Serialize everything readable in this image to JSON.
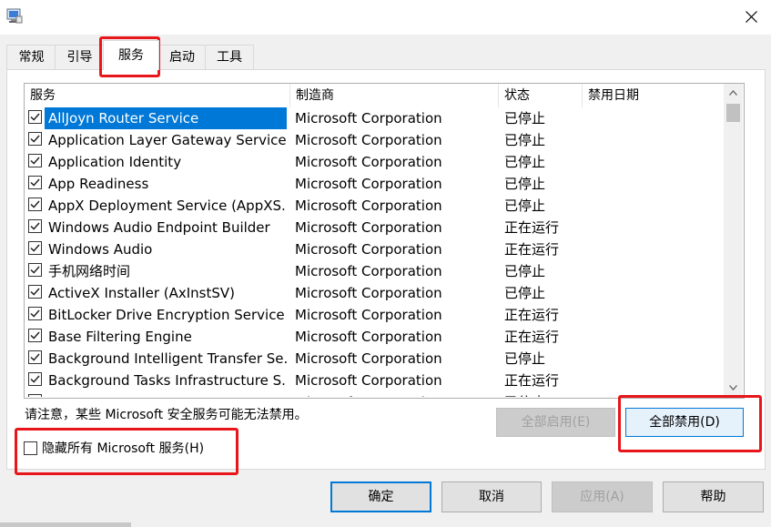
{
  "window": {
    "close_glyph": "✕"
  },
  "tabs": [
    {
      "label": "常规",
      "active": false
    },
    {
      "label": "引导",
      "active": false
    },
    {
      "label": "服务",
      "active": true
    },
    {
      "label": "启动",
      "active": false
    },
    {
      "label": "工具",
      "active": false
    }
  ],
  "services": {
    "columns": [
      "服务",
      "制造商",
      "状态",
      "禁用日期"
    ],
    "rows": [
      {
        "name": "AllJoyn Router Service",
        "maker": "Microsoft Corporation",
        "status": "已停止",
        "checked": true,
        "selected": true
      },
      {
        "name": "Application Layer Gateway Service",
        "maker": "Microsoft Corporation",
        "status": "已停止",
        "checked": true
      },
      {
        "name": "Application Identity",
        "maker": "Microsoft Corporation",
        "status": "已停止",
        "checked": true
      },
      {
        "name": "App Readiness",
        "maker": "Microsoft Corporation",
        "status": "已停止",
        "checked": true
      },
      {
        "name": "AppX Deployment Service (AppXS...",
        "maker": "Microsoft Corporation",
        "status": "已停止",
        "checked": true
      },
      {
        "name": "Windows Audio Endpoint Builder",
        "maker": "Microsoft Corporation",
        "status": "正在运行",
        "checked": true
      },
      {
        "name": "Windows Audio",
        "maker": "Microsoft Corporation",
        "status": "正在运行",
        "checked": true
      },
      {
        "name": "手机网络时间",
        "maker": "Microsoft Corporation",
        "status": "已停止",
        "checked": true
      },
      {
        "name": "ActiveX Installer (AxInstSV)",
        "maker": "Microsoft Corporation",
        "status": "已停止",
        "checked": true
      },
      {
        "name": "BitLocker Drive Encryption Service",
        "maker": "Microsoft Corporation",
        "status": "正在运行",
        "checked": true
      },
      {
        "name": "Base Filtering Engine",
        "maker": "Microsoft Corporation",
        "status": "正在运行",
        "checked": true
      },
      {
        "name": "Background Intelligent Transfer Se...",
        "maker": "Microsoft Corporation",
        "status": "已停止",
        "checked": true
      },
      {
        "name": "Background Tasks Infrastructure S...",
        "maker": "Microsoft Corporation",
        "status": "正在运行",
        "checked": true
      },
      {
        "name": "Computer Browser",
        "maker": "Microsoft Corporation",
        "status": "已停止",
        "checked": true
      }
    ]
  },
  "note": "请注意，某些 Microsoft 安全服务可能无法禁用。",
  "enable_all": "全部启用(E)",
  "disable_all": "全部禁用(D)",
  "hide_ms_label": "隐藏所有 Microsoft 服务(H)",
  "buttons": {
    "ok": "确定",
    "cancel": "取消",
    "apply": "应用(A)",
    "help": "帮助"
  },
  "colors": {
    "selection": "#0078d7",
    "annotation": "#e8161b",
    "dialog_bg": "#f0f0f0"
  }
}
